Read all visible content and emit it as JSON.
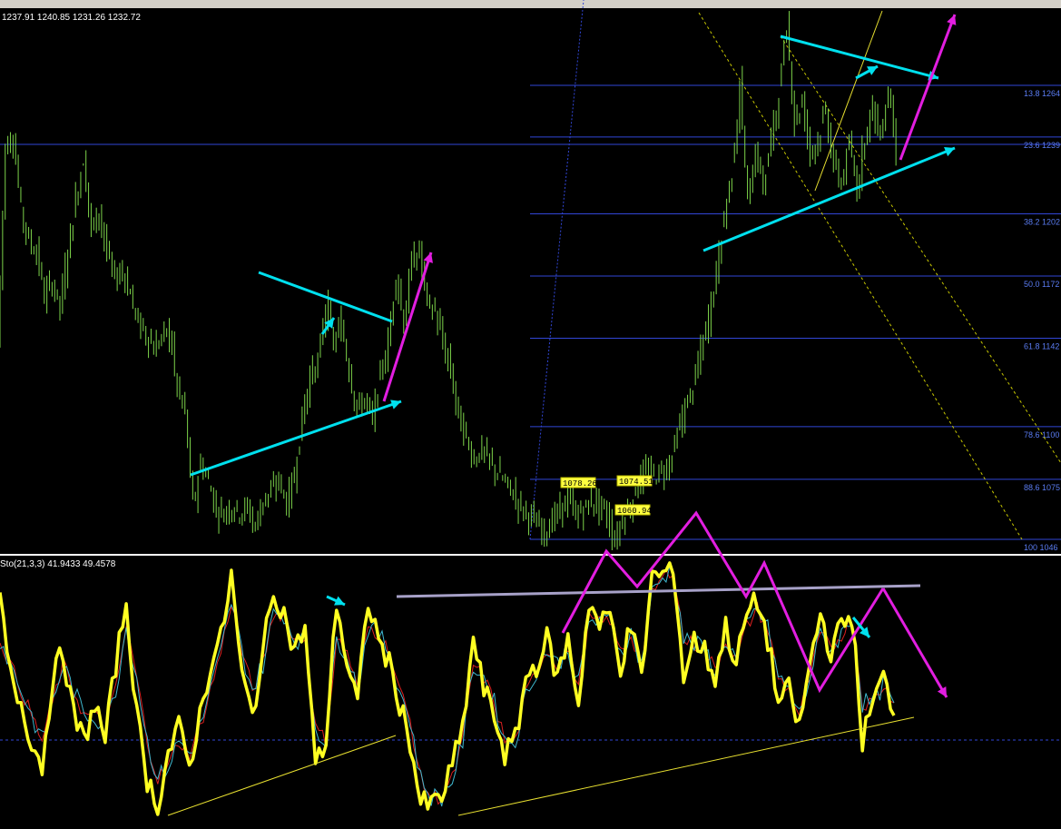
{
  "header": {
    "ohlc": "1237.91 1240.85 1231.26 1232.72",
    "oscillator": "Sto(21,3,3) 41.9433 49.4578"
  },
  "fib_levels": [
    {
      "label": "13.8 1264"
    },
    {
      "label": "23.6 1239"
    },
    {
      "label": "38.2 1202"
    },
    {
      "label": "50.0 1172"
    },
    {
      "label": "61.8 1142"
    },
    {
      "label": "78.6 1100"
    },
    {
      "label": "88.6 1075"
    },
    {
      "label": "100 1046"
    }
  ],
  "price_labels": [
    "1078.26",
    "1074.51",
    "1060.94"
  ],
  "colors": {
    "background": "#000000",
    "candles": "#7dd44a",
    "fib_lines": "#3146d6",
    "cyan": "#00e0ee",
    "magenta": "#e21ee0",
    "stoch_main": "#ffff22",
    "stoch_signal_red": "#dd2020",
    "stoch_signal_cyan": "#3fb8cf",
    "resistance": "#a7a1c8",
    "separator": "#ffffff"
  },
  "chart_data": [
    {
      "type": "candlestick",
      "title": "",
      "close_path": [
        1140,
        1236,
        1240,
        1205,
        1190,
        1185,
        1163,
        1170,
        1158,
        1185,
        1210,
        1230,
        1195,
        1205,
        1184,
        1172,
        1176,
        1164,
        1150,
        1145,
        1138,
        1143,
        1147,
        1118,
        1107,
        1062,
        1083,
        1074,
        1060,
        1059,
        1062,
        1059,
        1061,
        1052,
        1066,
        1068,
        1075,
        1063,
        1077,
        1105,
        1125,
        1130,
        1160,
        1140,
        1150,
        1128,
        1108,
        1114,
        1103,
        1126,
        1140,
        1175,
        1150,
        1180,
        1185,
        1160,
        1156,
        1140,
        1127,
        1105,
        1094,
        1085,
        1089,
        1083,
        1078,
        1073,
        1068,
        1061,
        1058,
        1053,
        1050,
        1055,
        1060,
        1066,
        1058,
        1060,
        1065,
        1062,
        1058,
        1045,
        1056,
        1062,
        1074,
        1078,
        1077,
        1079,
        1083,
        1097,
        1109,
        1120,
        1136,
        1153,
        1175,
        1202,
        1224,
        1264,
        1208,
        1234,
        1216,
        1239,
        1261,
        1294,
        1248,
        1257,
        1233,
        1239,
        1253,
        1226,
        1218,
        1236,
        1215,
        1241,
        1255,
        1239,
        1264,
        1235
      ],
      "ylim": [
        1046,
        1300
      ],
      "annotations": {
        "fibonacci": [
          13.8,
          23.6,
          38.2,
          50.0,
          61.8,
          78.6,
          88.6,
          100
        ]
      }
    },
    {
      "type": "line",
      "title": "",
      "series": [
        {
          "name": "Sto(21,3,3) main",
          "values": [
            85,
            55,
            45,
            30,
            20,
            55,
            65,
            40,
            30,
            45,
            30,
            60,
            85,
            40,
            15,
            5,
            25,
            35,
            20,
            40,
            60,
            70,
            95,
            55,
            40,
            65,
            90,
            80,
            65,
            75,
            20,
            30,
            85,
            60,
            45,
            85,
            70,
            60,
            45,
            30,
            5,
            5,
            8,
            20,
            35,
            70,
            50,
            40,
            25,
            30,
            55,
            60,
            70,
            55,
            70,
            45,
            85,
            75,
            80,
            60,
            75,
            55,
            95,
            95,
            100,
            55,
            70,
            65,
            55,
            75,
            60,
            80,
            85,
            70,
            45,
            50,
            35,
            60,
            80,
            65,
            75,
            80,
            30,
            45,
            55,
            40
          ]
        },
        {
          "name": "Sto(21,3,3) signal",
          "values": [
            70,
            60,
            50,
            40,
            30,
            45,
            60,
            50,
            40,
            40,
            35,
            50,
            75,
            55,
            30,
            15,
            20,
            30,
            25,
            35,
            50,
            65,
            85,
            65,
            50,
            60,
            80,
            80,
            70,
            70,
            35,
            30,
            70,
            65,
            50,
            75,
            72,
            65,
            50,
            38,
            15,
            8,
            8,
            15,
            30,
            60,
            55,
            45,
            30,
            30,
            48,
            58,
            66,
            60,
            66,
            52,
            78,
            76,
            78,
            65,
            72,
            60,
            88,
            94,
            98,
            70,
            68,
            66,
            58,
            70,
            62,
            75,
            82,
            74,
            55,
            50,
            40,
            55,
            72,
            66,
            72,
            78,
            45,
            45,
            52,
            45
          ]
        }
      ],
      "ylim": [
        0,
        100
      ]
    }
  ]
}
